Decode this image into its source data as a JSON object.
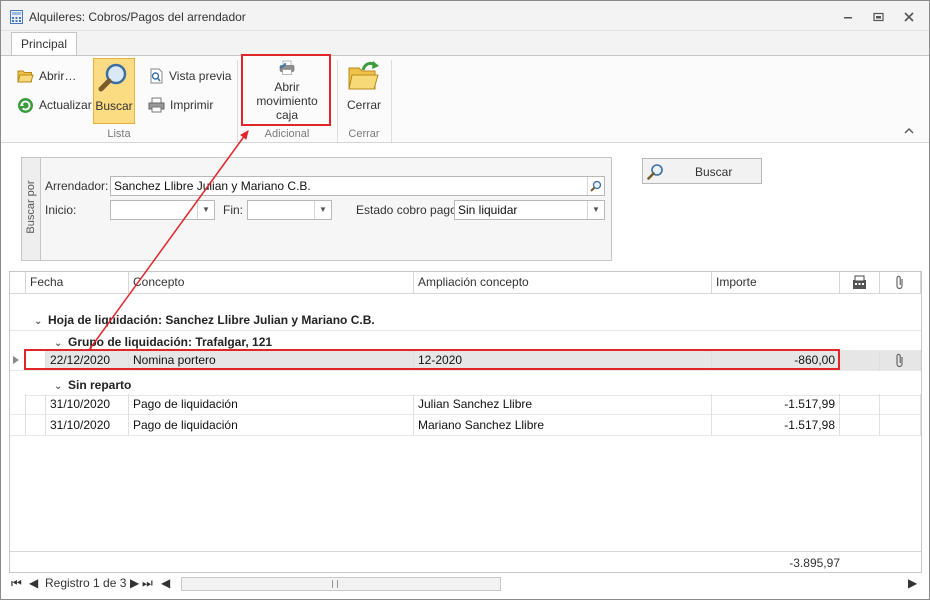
{
  "window": {
    "title": "Alquileres: Cobros/Pagos del arrendador"
  },
  "ribbon": {
    "tab": "Principal",
    "buttons": {
      "abrir": "Abrir…",
      "actualizar": "Actualizar",
      "buscar": "Buscar",
      "vista_previa": "Vista previa",
      "imprimir": "Imprimir",
      "abrir_mov_1": "Abrir",
      "abrir_mov_2": "movimiento caja",
      "cerrar": "Cerrar"
    },
    "groups": {
      "lista": "Lista",
      "adicional": "Adicional",
      "cerrar": "Cerrar"
    }
  },
  "search": {
    "panel_label": "Buscar por",
    "arrendador_label": "Arrendador:",
    "arrendador_value": "Sanchez Llibre Julian y Mariano C.B.",
    "inicio_label": "Inicio:",
    "inicio_value": "",
    "fin_label": "Fin:",
    "fin_value": "",
    "estado_label": "Estado cobro pago:",
    "estado_value": "Sin liquidar",
    "buscar_button": "Buscar"
  },
  "grid": {
    "columns": {
      "fecha": "Fecha",
      "concepto": "Concepto",
      "ampliacion": "Ampliación concepto",
      "importe": "Importe"
    },
    "group1": "Hoja de liquidación: Sanchez Llibre Julian y Mariano C.B.",
    "group2": "Grupo de liquidación: Trafalgar, 121",
    "group3": "Sin reparto",
    "rows": [
      {
        "fecha": "22/12/2020",
        "concepto": "Nomina portero",
        "ampliacion": "12-2020",
        "importe": "-860,00"
      },
      {
        "fecha": "31/10/2020",
        "concepto": "Pago de liquidación",
        "ampliacion": "Julian Sanchez Llibre",
        "importe": "-1.517,99"
      },
      {
        "fecha": "31/10/2020",
        "concepto": "Pago de liquidación",
        "ampliacion": "Mariano Sanchez Llibre",
        "importe": "-1.517,98"
      }
    ],
    "total": "-3.895,97"
  },
  "navigator": {
    "record": "Registro 1 de 3"
  }
}
